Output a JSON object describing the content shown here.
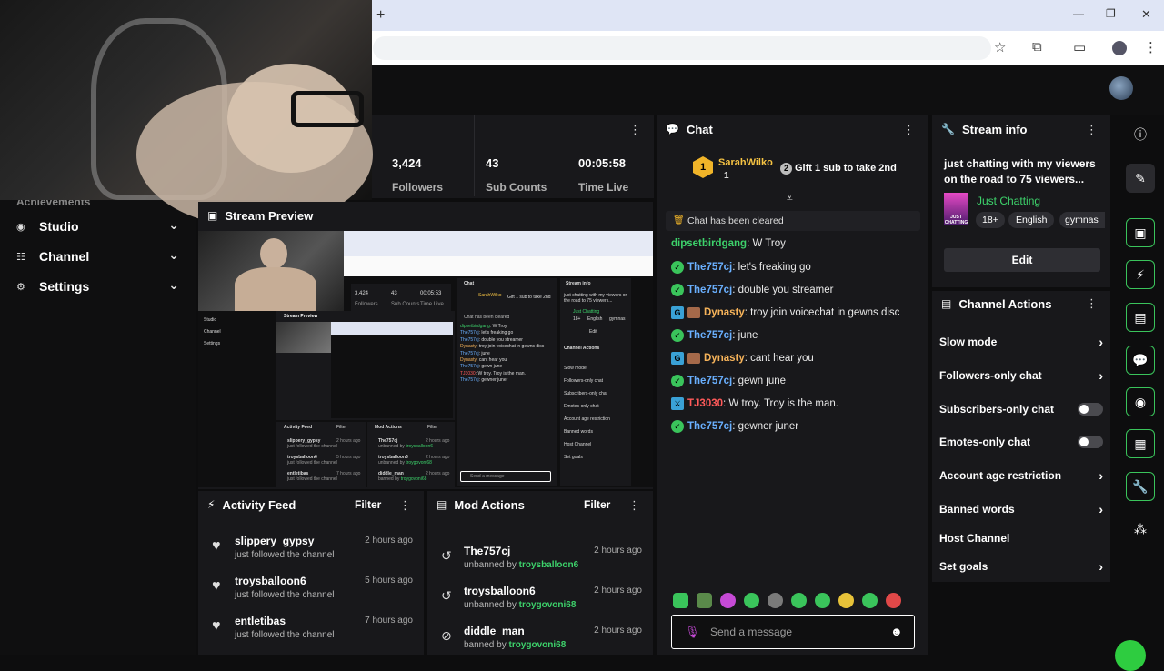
{
  "browser": {
    "new_tab": "+",
    "min": "—",
    "max": "❐",
    "close": "✕"
  },
  "stats": [
    {
      "value": "3,424",
      "label": "Followers"
    },
    {
      "value": "43",
      "label": "Sub Counts"
    },
    {
      "value": "00:05:58",
      "label": "Time Live"
    }
  ],
  "sidebar": {
    "partial_label": "Achievements",
    "items": [
      {
        "label": "Studio"
      },
      {
        "label": "Channel"
      },
      {
        "label": "Settings"
      }
    ]
  },
  "stream_preview": {
    "title": "Stream Preview",
    "mini": {
      "followers": "3,424",
      "followers_label": "Followers",
      "subs": "43",
      "subs_label": "Sub Counts",
      "time": "00:05:53",
      "time_label": "Time Live",
      "chat_title": "Chat",
      "info_title": "Stream info",
      "info_text": "just chatting with my viewers on the road to 75 viewers...",
      "category": "Just Chatting",
      "tags": [
        "18+",
        "English",
        "gymnas"
      ],
      "edit": "Edit",
      "gift_user": "SarahWilko",
      "gift_text": "Gift 1 sub to take 2nd",
      "cleared": "Chat has been cleared",
      "side": [
        "Studio",
        "Channel",
        "Settings"
      ],
      "preview": "Stream Preview",
      "actions_title": "Channel Actions",
      "actions": [
        "Slow mode",
        "Followers-only chat",
        "Subscribers-only chat",
        "Emotes-only chat",
        "Account age restriction",
        "Banned words",
        "Host Channel",
        "Set goals"
      ],
      "feed_title": "Activity Feed",
      "mods_title": "Mod Actions",
      "filter": "Filter",
      "feed": [
        {
          "name": "slippery_gypsy",
          "time": "2 hours ago",
          "sub": "just followed the channel"
        },
        {
          "name": "troysballoon6",
          "time": "5 hours ago",
          "sub": "just followed the channel"
        },
        {
          "name": "entletibas",
          "time": "7 hours ago",
          "sub": "just followed the channel"
        }
      ],
      "mods": [
        {
          "name": "The757cj",
          "sub": "unbanned by",
          "by": "troysballoon6",
          "time": "2 hours ago"
        },
        {
          "name": "troysballoon6",
          "sub": "unbanned by",
          "by": "troygovoni68",
          "time": "2 hours ago"
        },
        {
          "name": "diddle_man",
          "sub": "banned by",
          "by": "troygovoni68",
          "time": "2 hours ago"
        }
      ],
      "chat": [
        {
          "u": "dipsetbirdgang",
          "t": "W Troy"
        },
        {
          "u": "The757cj",
          "t": "let's freaking go"
        },
        {
          "u": "The757cj",
          "t": "double you streamer"
        },
        {
          "u": "Dynasty",
          "t": "troy join voicechat in gewns disc"
        },
        {
          "u": "The757cj",
          "t": "june"
        },
        {
          "u": "Dynasty",
          "t": "cant hear you"
        },
        {
          "u": "The757cj",
          "t": "gewn june"
        },
        {
          "u": "TJ3030",
          "t": "W troy. Troy is the man."
        },
        {
          "u": "The757cj",
          "t": "gewner juner"
        }
      ],
      "send": "Send a message"
    }
  },
  "activity_feed": {
    "title": "Activity Feed",
    "filter": "Filter",
    "items": [
      {
        "name": "slippery_gypsy",
        "sub": "just followed the channel",
        "time": "2 hours ago"
      },
      {
        "name": "troysballoon6",
        "sub": "just followed the channel",
        "time": "5 hours ago"
      },
      {
        "name": "entletibas",
        "sub": "just followed the channel",
        "time": "7 hours ago"
      }
    ]
  },
  "mod_actions": {
    "title": "Mod Actions",
    "filter": "Filter",
    "items": [
      {
        "name": "The757cj",
        "action": "unbanned by",
        "by": "troysballoon6",
        "time": "2 hours ago"
      },
      {
        "name": "troysballoon6",
        "action": "unbanned by",
        "by": "troygovoni68",
        "time": "2 hours ago"
      },
      {
        "name": "diddle_man",
        "action": "banned by",
        "by": "troygovoni68",
        "time": "2 hours ago"
      }
    ]
  },
  "chat": {
    "title": "Chat",
    "gift": {
      "rank": "1",
      "user": "SarahWilko",
      "count": "1",
      "num": "2",
      "text": "Gift 1 sub to take 2nd"
    },
    "cleared": "Chat has been cleared",
    "messages": [
      {
        "user": "dipsetbirdgang",
        "text": "W Troy",
        "color": "#3dd26b"
      },
      {
        "user": "The757cj",
        "text": "let's freaking go",
        "color": "#6ab0ff"
      },
      {
        "user": "The757cj",
        "text": "double you streamer",
        "color": "#6ab0ff"
      },
      {
        "user": "Dynasty",
        "text": "troy join voicechat in gewns disc",
        "color": "#f6b35a"
      },
      {
        "user": "The757cj",
        "text": "june",
        "color": "#6ab0ff"
      },
      {
        "user": "Dynasty",
        "text": "cant hear you",
        "color": "#f6b35a"
      },
      {
        "user": "The757cj",
        "text": "gewn june",
        "color": "#6ab0ff"
      },
      {
        "user": "TJ3030",
        "text": "W troy. Troy is the man.",
        "color": "#ff5a5a"
      },
      {
        "user": "The757cj",
        "text": "gewner juner",
        "color": "#6ab0ff"
      }
    ],
    "send_placeholder": "Send a message"
  },
  "stream_info": {
    "title": "Stream info",
    "text": "just chatting with my viewers on the road to 75 viewers...",
    "category": "Just Chatting",
    "thumb_text": "JUST CHATTING",
    "tags": [
      "18+",
      "English",
      "gymnas"
    ],
    "edit": "Edit"
  },
  "channel_actions": {
    "title": "Channel Actions",
    "items": [
      {
        "label": "Slow mode",
        "kind": "arrow"
      },
      {
        "label": "Followers-only chat",
        "kind": "arrow"
      },
      {
        "label": "Subscribers-only chat",
        "kind": "toggle"
      },
      {
        "label": "Emotes-only chat",
        "kind": "toggle"
      },
      {
        "label": "Account age restriction",
        "kind": "arrow"
      },
      {
        "label": "Banned words",
        "kind": "arrow"
      },
      {
        "label": "Host Channel",
        "kind": "none"
      },
      {
        "label": "Set goals",
        "kind": "arrow"
      }
    ]
  },
  "colors": {
    "accent": "#3ac45b",
    "panel": "#18181b",
    "bg": "#0d0d0e"
  }
}
